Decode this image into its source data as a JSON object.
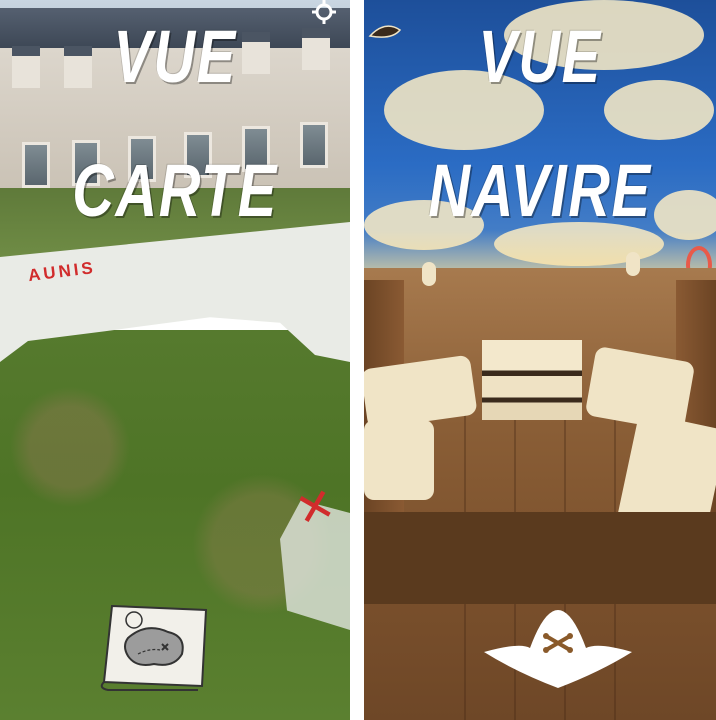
{
  "left_view": {
    "title_line1": "VUE",
    "title_line2": "CARTE",
    "map_region_label": "AUNIS",
    "map_button_icon": "treasure-map-scroll-icon",
    "settings_icon": "gear-icon",
    "marker_icon": "red-x-marker"
  },
  "right_view": {
    "title_line1": "VUE",
    "title_line2": "NAVIRE",
    "ship_icon": "ship-icon",
    "hat_button_icon": "pirate-hat-icon"
  },
  "colors": {
    "title_text": "#ffffff",
    "map_label": "#d12c2c",
    "sky": "#2b6cc4",
    "deck": "#8a5e36"
  }
}
